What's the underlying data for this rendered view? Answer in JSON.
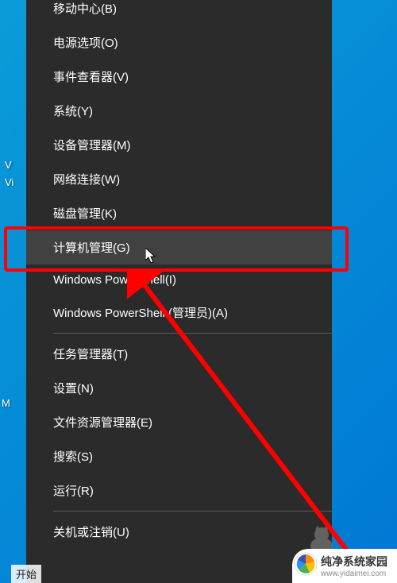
{
  "desktop": {
    "label1": "V",
    "label2": "Vi",
    "label3": "M"
  },
  "menu": {
    "items": [
      "移动中心(B)",
      "电源选项(O)",
      "事件查看器(V)",
      "系统(Y)",
      "设备管理器(M)",
      "网络连接(W)",
      "磁盘管理(K)",
      "计算机管理(G)",
      "Windows PowerShell(I)",
      "Windows PowerShell (管理员)(A)",
      "任务管理器(T)",
      "设置(N)",
      "文件资源管理器(E)",
      "搜索(S)",
      "运行(R)",
      "关机或注销(U)"
    ],
    "highlighted_index": 7
  },
  "start": {
    "label": "开始"
  },
  "watermark": {
    "title": "纯净系统家园",
    "url": "www.yidaimei.com"
  }
}
